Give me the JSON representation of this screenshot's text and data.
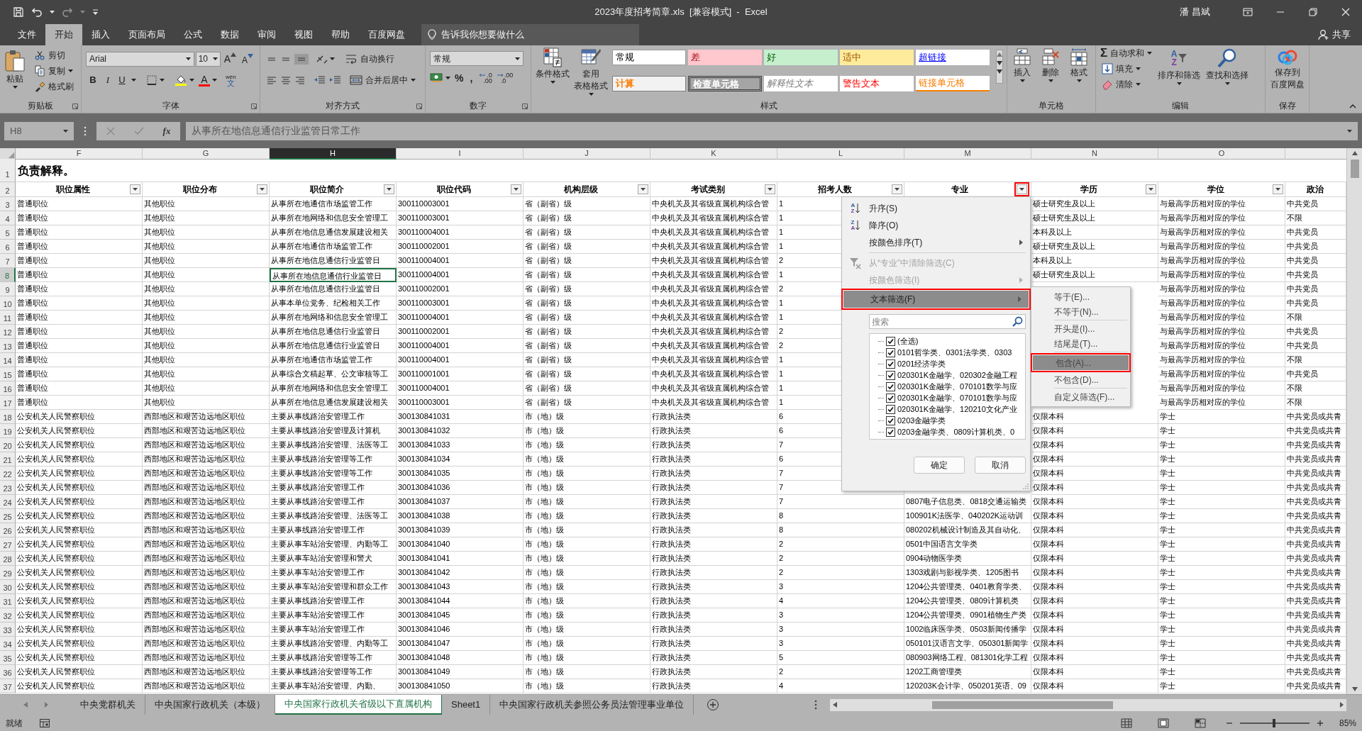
{
  "title_bar": {
    "title": "2023年度招考简章.xls  [兼容模式]  -  Excel",
    "user": "潘 昌斌"
  },
  "menu_tabs": [
    {
      "label": "文件",
      "selected": false
    },
    {
      "label": "开始",
      "selected": true
    },
    {
      "label": "插入",
      "selected": false
    },
    {
      "label": "页面布局",
      "selected": false
    },
    {
      "label": "公式",
      "selected": false
    },
    {
      "label": "数据",
      "selected": false
    },
    {
      "label": "审阅",
      "selected": false
    },
    {
      "label": "视图",
      "selected": false
    },
    {
      "label": "帮助",
      "selected": false
    },
    {
      "label": "百度网盘",
      "selected": false
    }
  ],
  "tell_me": {
    "placeholder": "告诉我你想要做什么"
  },
  "share": "共享",
  "ribbon": {
    "clipboard": {
      "paste": "粘贴",
      "cut": "剪切",
      "copy": "复制",
      "format_painter": "格式刷",
      "label": "剪贴板"
    },
    "font": {
      "font_name": "Arial",
      "font_size": "10",
      "grow": "A",
      "shrink": "A",
      "bold": "B",
      "italic": "I",
      "underline": "U",
      "font_color": "A",
      "phonetic": [
        "wén",
        "文"
      ],
      "label": "字体"
    },
    "alignment": {
      "wrap": "自动换行",
      "merge": "合并后居中",
      "label": "对齐方式"
    },
    "number": {
      "format": "常规",
      "percent": "%",
      "comma": ",",
      "increase_decimal": [
        ".0",
        ".00"
      ],
      "decrease_decimal": [
        ".00",
        ".0"
      ],
      "label": "数字"
    },
    "styles": {
      "conditional": "条件格式",
      "table_format": [
        "套用",
        "表格格式"
      ],
      "label": "样式",
      "gallery": [
        {
          "label": "常规",
          "kind": "normal"
        },
        {
          "label": "差",
          "kind": "bad"
        },
        {
          "label": "好",
          "kind": "good"
        },
        {
          "label": "适中",
          "kind": "neutral"
        },
        {
          "label": "超链接",
          "kind": "hyperlink"
        },
        {
          "label": "计算",
          "kind": "calculation"
        },
        {
          "label": "检查单元格",
          "kind": "check"
        },
        {
          "label": "解释性文本",
          "kind": "explanatory"
        },
        {
          "label": "警告文本",
          "kind": "warning"
        },
        {
          "label": "链接单元格",
          "kind": "linked"
        }
      ]
    },
    "cells": {
      "insert": "插入",
      "delete": "删除",
      "format": "格式",
      "label": "单元格"
    },
    "editing": {
      "autosum_symbol": "Σ",
      "autosum": "自动求和",
      "fill": "填充",
      "clear": "清除",
      "sort_icon_letters": [
        "A",
        "Z"
      ],
      "sort": "排序和筛选",
      "find": "查找和选择",
      "label": "编辑"
    },
    "save": {
      "lines": [
        "保存到",
        "百度网盘"
      ],
      "label": "保存"
    }
  },
  "formula_bar": {
    "name_box": "H8",
    "fx": "fx",
    "formula": "从事所在地信息通信行业监管日常工作"
  },
  "sheet": {
    "columns": [
      {
        "letter": "F",
        "selected": false
      },
      {
        "letter": "G",
        "selected": false
      },
      {
        "letter": "H",
        "selected": true
      },
      {
        "letter": "I",
        "selected": false
      },
      {
        "letter": "J",
        "selected": false
      },
      {
        "letter": "K",
        "selected": false
      },
      {
        "letter": "L",
        "selected": false
      },
      {
        "letter": "M",
        "selected": false
      },
      {
        "letter": "N",
        "selected": false
      },
      {
        "letter": "O",
        "selected": false
      }
    ],
    "title_row": {
      "number": "1",
      "text": "负责解释。"
    },
    "header_row": {
      "number": "2",
      "headers": [
        {
          "label": "职位属性",
          "filter_button": true,
          "outlined": false
        },
        {
          "label": "职位分布",
          "filter_button": true,
          "outlined": false
        },
        {
          "label": "职位简介",
          "filter_button": true,
          "outlined": false
        },
        {
          "label": "职位代码",
          "filter_button": true,
          "outlined": false
        },
        {
          "label": "机构层级",
          "filter_button": true,
          "outlined": false
        },
        {
          "label": "考试类别",
          "filter_button": true,
          "outlined": false
        },
        {
          "label": "招考人数",
          "filter_button": true,
          "outlined": false
        },
        {
          "label": "专业",
          "filter_button": true,
          "outlined": true
        },
        {
          "label": "学历",
          "filter_button": true,
          "outlined": false
        },
        {
          "label": "学位",
          "filter_button": true,
          "outlined": false
        },
        {
          "label": "政治",
          "filter_button": false
        }
      ]
    },
    "rows": [
      {
        "number": "3",
        "selected": false,
        "cells": [
          "普通职位",
          "其他职位",
          "从事所在地通信市场监管工作",
          "300110003001",
          "省（副省）级",
          "中央机关及其省级直属机构综合管",
          "1",
          null,
          "硕士研究生及以上",
          "与最高学历相对应的学位",
          "中共党员"
        ]
      },
      {
        "number": "4",
        "selected": false,
        "cells": [
          "普通职位",
          "其他职位",
          "从事所在地网络和信息安全管理工",
          "300110003001",
          "省（副省）级",
          "中央机关及其省级直属机构综合管",
          "1",
          null,
          "硕士研究生及以上",
          "与最高学历相对应的学位",
          "不限"
        ]
      },
      {
        "number": "5",
        "selected": false,
        "cells": [
          "普通职位",
          "其他职位",
          "从事所在地信息通信发展建设相关",
          "300110004001",
          "省（副省）级",
          "中央机关及其省级直属机构综合管",
          "1",
          null,
          "本科及以上",
          "与最高学历相对应的学位",
          "中共党员"
        ]
      },
      {
        "number": "6",
        "selected": false,
        "cells": [
          "普通职位",
          "其他职位",
          "从事所在地通信市场监管工作",
          "300110002001",
          "省（副省）级",
          "中央机关及其省级直属机构综合管",
          "1",
          null,
          "硕士研究生及以上",
          "与最高学历相对应的学位",
          "中共党员"
        ]
      },
      {
        "number": "7",
        "selected": false,
        "cells": [
          "普通职位",
          "其他职位",
          "从事所在地信息通信行业监管日",
          "300110004001",
          "省（副省）级",
          "中央机关及其省级直属机构综合管",
          "2",
          null,
          "本科及以上",
          "与最高学历相对应的学位",
          "中共党员"
        ]
      },
      {
        "number": "8",
        "selected": true,
        "cells": [
          "普通职位",
          "其他职位",
          "从事所在地信息通信行业监管日",
          "300110004001",
          "省（副省）级",
          "中央机关及其省级直属机构综合管",
          "1",
          null,
          "硕士研究生及以上",
          "与最高学历相对应的学位",
          "中共党员"
        ]
      },
      {
        "number": "9",
        "selected": false,
        "cells": [
          "普通职位",
          "其他职位",
          "从事所在地信息通信行业监管日",
          "300110002001",
          "省（副省）级",
          "中央机关及其省级直属机构综合管",
          "2",
          null,
          null,
          "与最高学历相对应的学位",
          "中共党员"
        ]
      },
      {
        "number": "10",
        "selected": false,
        "cells": [
          "普通职位",
          "其他职位",
          "从事本单位党务、纪检相关工作",
          "300110003001",
          "省（副省）级",
          "中央机关及其省级直属机构综合管",
          "1",
          null,
          null,
          "与最高学历相对应的学位",
          "中共党员"
        ]
      },
      {
        "number": "11",
        "selected": false,
        "cells": [
          "普通职位",
          "其他职位",
          "从事所在地网络和信息安全管理工",
          "300110004001",
          "省（副省）级",
          "中央机关及其省级直属机构综合管",
          "1",
          null,
          null,
          "与最高学历相对应的学位",
          "不限"
        ]
      },
      {
        "number": "12",
        "selected": false,
        "cells": [
          "普通职位",
          "其他职位",
          "从事所在地信息通信行业监管日",
          "300110002001",
          "省（副省）级",
          "中央机关及其省级直属机构综合管",
          "2",
          null,
          null,
          "与最高学历相对应的学位",
          "中共党员"
        ]
      },
      {
        "number": "13",
        "selected": false,
        "cells": [
          "普通职位",
          "其他职位",
          "从事所在地信息通信行业监管日",
          "300110004001",
          "省（副省）级",
          "中央机关及其省级直属机构综合管",
          "2",
          null,
          null,
          "与最高学历相对应的学位",
          "中共党员"
        ]
      },
      {
        "number": "14",
        "selected": false,
        "cells": [
          "普通职位",
          "其他职位",
          "从事所在地通信市场监管工作",
          "300110004001",
          "省（副省）级",
          "中央机关及其省级直属机构综合管",
          "1",
          null,
          null,
          "与最高学历相对应的学位",
          "不限"
        ]
      },
      {
        "number": "15",
        "selected": false,
        "cells": [
          "普通职位",
          "其他职位",
          "从事综合文稿起草、公文审核等工",
          "300110001001",
          "省（副省）级",
          "中央机关及其省级直属机构综合管",
          "1",
          null,
          null,
          "与最高学历相对应的学位",
          "中共党员"
        ]
      },
      {
        "number": "16",
        "selected": false,
        "cells": [
          "普通职位",
          "其他职位",
          "从事所在地网络和信息安全管理工",
          "300110004001",
          "省（副省）级",
          "中央机关及其省级直属机构综合管",
          "1",
          null,
          null,
          "与最高学历相对应的学位",
          "不限"
        ]
      },
      {
        "number": "17",
        "selected": false,
        "cells": [
          "普通职位",
          "其他职位",
          "从事所在地信息通信发展建设相关",
          "300110003001",
          "省（副省）级",
          "中央机关及其省级直属机构综合管",
          "1",
          null,
          null,
          "与最高学历相对应的学位",
          "不限"
        ]
      },
      {
        "number": "18",
        "selected": false,
        "cells": [
          "公安机关人民警察职位",
          "西部地区和艰苦边远地区职位",
          "主要从事线路治安管理工作",
          "300130841031",
          "市（地）级",
          "行政执法类",
          "6",
          null,
          "仅限本科",
          "学士",
          "中共党员或共青"
        ]
      },
      {
        "number": "19",
        "selected": false,
        "cells": [
          "公安机关人民警察职位",
          "西部地区和艰苦边远地区职位",
          "主要从事线路治安管理及计算机",
          "300130841032",
          "市（地）级",
          "行政执法类",
          "6",
          null,
          "仅限本科",
          "学士",
          "中共党员或共青"
        ]
      },
      {
        "number": "20",
        "selected": false,
        "cells": [
          "公安机关人民警察职位",
          "西部地区和艰苦边远地区职位",
          "主要从事线路治安管理、法医等工",
          "300130841033",
          "市（地）级",
          "行政执法类",
          "7",
          null,
          "仅限本科",
          "学士",
          "中共党员或共青"
        ]
      },
      {
        "number": "21",
        "selected": false,
        "cells": [
          "公安机关人民警察职位",
          "西部地区和艰苦边远地区职位",
          "主要从事线路治安管理等工作",
          "300130841034",
          "市（地）级",
          "行政执法类",
          "6",
          null,
          "仅限本科",
          "学士",
          "中共党员或共青"
        ]
      },
      {
        "number": "22",
        "selected": false,
        "cells": [
          "公安机关人民警察职位",
          "西部地区和艰苦边远地区职位",
          "主要从事线路治安管理等工作",
          "300130841035",
          "市（地）级",
          "行政执法类",
          "7",
          null,
          "仅限本科",
          "学士",
          "中共党员或共青"
        ]
      },
      {
        "number": "23",
        "selected": false,
        "cells": [
          "公安机关人民警察职位",
          "西部地区和艰苦边远地区职位",
          "主要从事线路治安管理工作",
          "300130841036",
          "市（地）级",
          "行政执法类",
          "7",
          null,
          "仅限本科",
          "学士",
          "中共党员或共青"
        ]
      },
      {
        "number": "24",
        "selected": false,
        "cells": [
          "公安机关人民警察职位",
          "西部地区和艰苦边远地区职位",
          "主要从事线路治安管理工作",
          "300130841037",
          "市（地）级",
          "行政执法类",
          "7",
          "0807电子信息类、0818交通运输类",
          "仅限本科",
          "学士",
          "中共党员或共青"
        ]
      },
      {
        "number": "25",
        "selected": false,
        "cells": [
          "公安机关人民警察职位",
          "西部地区和艰苦边远地区职位",
          "主要从事线路治安管理、法医等工",
          "300130841038",
          "市（地）级",
          "行政执法类",
          "8",
          "100901K法医学、040202K运动训",
          "仅限本科",
          "学士",
          "中共党员或共青"
        ]
      },
      {
        "number": "26",
        "selected": false,
        "cells": [
          "公安机关人民警察职位",
          "西部地区和艰苦边远地区职位",
          "主要从事线路治安管理工作",
          "300130841039",
          "市（地）级",
          "行政执法类",
          "8",
          "080202机械设计制造及其自动化、",
          "仅限本科",
          "学士",
          "中共党员或共青"
        ]
      },
      {
        "number": "27",
        "selected": false,
        "cells": [
          "公安机关人民警察职位",
          "西部地区和艰苦边远地区职位",
          "主要从事车站治安管理、内勤等工",
          "300130841040",
          "市（地）级",
          "行政执法类",
          "2",
          "0501中国语言文学类",
          "仅限本科",
          "学士",
          "中共党员或共青"
        ]
      },
      {
        "number": "28",
        "selected": false,
        "cells": [
          "公安机关人民警察职位",
          "西部地区和艰苦边远地区职位",
          "主要从事车站治安管理和警犬",
          "300130841041",
          "市（地）级",
          "行政执法类",
          "2",
          "0904动物医学类",
          "仅限本科",
          "学士",
          "中共党员或共青"
        ]
      },
      {
        "number": "29",
        "selected": false,
        "cells": [
          "公安机关人民警察职位",
          "西部地区和艰苦边远地区职位",
          "主要从事车站治安管理工作",
          "300130841042",
          "市（地）级",
          "行政执法类",
          "2",
          "1303戏剧与影视学类、1205图书",
          "仅限本科",
          "学士",
          "中共党员或共青"
        ]
      },
      {
        "number": "30",
        "selected": false,
        "cells": [
          "公安机关人民警察职位",
          "西部地区和艰苦边远地区职位",
          "主要从事车站治安管理和群众工作",
          "300130841043",
          "市（地）级",
          "行政执法类",
          "3",
          "1204公共管理类、0401教育学类、",
          "仅限本科",
          "学士",
          "中共党员或共青"
        ]
      },
      {
        "number": "31",
        "selected": false,
        "cells": [
          "公安机关人民警察职位",
          "西部地区和艰苦边远地区职位",
          "主要从事线路治安管理工作",
          "300130841044",
          "市（地）级",
          "行政执法类",
          "4",
          "1204公共管理类、0809计算机类",
          "仅限本科",
          "学士",
          "中共党员或共青"
        ]
      },
      {
        "number": "32",
        "selected": false,
        "cells": [
          "公安机关人民警察职位",
          "西部地区和艰苦边远地区职位",
          "主要从事车站治安管理工作",
          "300130841045",
          "市（地）级",
          "行政执法类",
          "3",
          "1204公共管理类、0901植物生产类",
          "仅限本科",
          "学士",
          "中共党员或共青"
        ]
      },
      {
        "number": "33",
        "selected": false,
        "cells": [
          "公安机关人民警察职位",
          "西部地区和艰苦边远地区职位",
          "主要从事车站治安管理工作",
          "300130841046",
          "市（地）级",
          "行政执法类",
          "3",
          "1002临床医学类、0503新闻传播学",
          "仅限本科",
          "学士",
          "中共党员或共青"
        ]
      },
      {
        "number": "34",
        "selected": false,
        "cells": [
          "公安机关人民警察职位",
          "西部地区和艰苦边远地区职位",
          "主要从事线路治安管理、内勤等工",
          "300130841047",
          "市（地）级",
          "行政执法类",
          "3",
          "050101汉语言文学、050301新闻学",
          "仅限本科",
          "学士",
          "中共党员或共青"
        ]
      },
      {
        "number": "35",
        "selected": false,
        "cells": [
          "公安机关人民警察职位",
          "西部地区和艰苦边远地区职位",
          "主要从事线路治安管理等工作",
          "300130841048",
          "市（地）级",
          "行政执法类",
          "5",
          "080903网络工程、081301化学工程",
          "仅限本科",
          "学士",
          "中共党员或共青"
        ]
      },
      {
        "number": "36",
        "selected": false,
        "cells": [
          "公安机关人民警察职位",
          "西部地区和艰苦边远地区职位",
          "主要从事线路治安管理等工作",
          "300130841049",
          "市（地）级",
          "行政执法类",
          "2",
          "1202工商管理类",
          "仅限本科",
          "学士",
          "中共党员或共青"
        ]
      },
      {
        "number": "37",
        "selected": false,
        "cells": [
          "公安机关人民警察职位",
          "西部地区和艰苦边远地区职位",
          "主要从事车站治安管理、内勤、",
          "300130841050",
          "市（地）级",
          "行政执法类",
          "4",
          "120203K会计学、050201英语、09",
          "仅限本科",
          "学士",
          "中共党员或共青"
        ]
      }
    ]
  },
  "filter_menu": {
    "items": [
      {
        "kind": "sort",
        "label": "升序(S)",
        "icon_letters": [
          "A",
          "Z"
        ],
        "disabled": false,
        "selected": false,
        "outlined": false
      },
      {
        "kind": "sort",
        "label": "降序(O)",
        "icon_letters": [
          "Z",
          "A"
        ],
        "disabled": false,
        "selected": false,
        "outlined": false
      },
      {
        "kind": "submenu",
        "label": "按颜色排序(T)",
        "disabled": false,
        "selected": false,
        "outlined": false
      },
      {
        "kind": "separator"
      },
      {
        "kind": "clear",
        "label": "从“专业”中清除筛选(C)",
        "disabled": true,
        "selected": false,
        "outlined": false
      },
      {
        "kind": "submenu",
        "label": "按颜色筛选(I)",
        "disabled": true,
        "selected": false,
        "outlined": false
      },
      {
        "kind": "submenu",
        "label": "文本筛选(F)",
        "disabled": false,
        "selected": true,
        "outlined": true
      }
    ],
    "search": {
      "placeholder": "搜索"
    },
    "values": [
      {
        "label": "(全选)",
        "checked": true
      },
      {
        "label": "0101哲学类、0301法学类、0303",
        "checked": true
      },
      {
        "label": "0201经济学类",
        "checked": true
      },
      {
        "label": "020301K金融学、020302金融工程",
        "checked": true
      },
      {
        "label": "020301K金融学、070101数学与应",
        "checked": true
      },
      {
        "label": "020301K金融学、070101数学与应",
        "checked": true
      },
      {
        "label": "020301K金融学、120210文化产业",
        "checked": true
      },
      {
        "label": "0203金融学类",
        "checked": true
      },
      {
        "label": "0203金融学类、0809计算机类、0",
        "checked": true
      }
    ],
    "buttons": [
      "确定",
      "取消"
    ]
  },
  "text_filter_submenu": [
    {
      "kind": "item",
      "label": "等于(E)...",
      "selected": false,
      "outlined": false
    },
    {
      "kind": "item",
      "label": "不等于(N)...",
      "selected": false,
      "outlined": false
    },
    {
      "kind": "separator"
    },
    {
      "kind": "item",
      "label": "开头是(I)...",
      "selected": false,
      "outlined": false
    },
    {
      "kind": "item",
      "label": "结尾是(T)...",
      "selected": false,
      "outlined": false
    },
    {
      "kind": "separator"
    },
    {
      "kind": "item",
      "label": "包含(A)...",
      "selected": true,
      "outlined": true
    },
    {
      "kind": "item",
      "label": "不包含(D)...",
      "selected": false,
      "outlined": false
    },
    {
      "kind": "separator"
    },
    {
      "kind": "item",
      "label": "自定义筛选(F)...",
      "selected": false,
      "outlined": false
    }
  ],
  "sheet_tabs": [
    {
      "label": "中央党群机关",
      "selected": false
    },
    {
      "label": "中央国家行政机关（本级）",
      "selected": false
    },
    {
      "label": "中央国家行政机关省级以下直属机构",
      "selected": true
    },
    {
      "label": "Sheet1",
      "selected": false
    },
    {
      "label": "中央国家行政机关参照公务员法管理事业单位",
      "selected": false
    }
  ],
  "status_bar": {
    "status": "就绪",
    "zoom": {
      "label": "85%",
      "level": 0.49
    }
  }
}
